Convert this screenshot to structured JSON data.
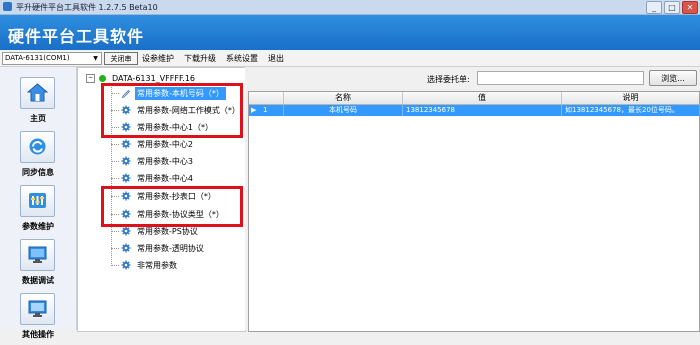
{
  "window": {
    "title": "平升硬件平台工具软件 1.2.7.5 Beta10",
    "minimize": "_",
    "maximize": "□",
    "close": "✕"
  },
  "banner": {
    "title": "硬件平台工具软件"
  },
  "toolbar": {
    "port_select": "DATA-6131(COM1)",
    "close_button": "关闭串",
    "menus": [
      "设参维护",
      "下载升级",
      "系统设置",
      "退出"
    ]
  },
  "sidebar": {
    "items": [
      {
        "label": "主页",
        "icon": "home-icon"
      },
      {
        "label": "同步信息",
        "icon": "sync-icon"
      },
      {
        "label": "参数维护",
        "icon": "parameters-icon"
      },
      {
        "label": "数据调试",
        "icon": "monitor-icon"
      },
      {
        "label": "其他操作",
        "icon": "computer-icon"
      }
    ]
  },
  "tree": {
    "root": "DATA-6131_VFFFF.16",
    "items": [
      "常用参数-本机号码（*）",
      "常用参数-网络工作模式（*）",
      "常用参数-中心1（*）",
      "常用参数-中心2",
      "常用参数-中心3",
      "常用参数-中心4",
      "常用参数-抄表口（*）",
      "常用参数-协议类型（*）",
      "常用参数-PS协议",
      "常用参数-透明协议",
      "非常用参数"
    ],
    "selected_index": 0
  },
  "delegate": {
    "label": "选择委托单:",
    "value": "",
    "browse": "浏览..."
  },
  "grid": {
    "columns": [
      "名称",
      "值",
      "说明"
    ],
    "rows": [
      {
        "marker": "▶",
        "index": "1",
        "name": "本机号码",
        "value": "13812345678",
        "desc": "如13812345678，最长20位号码。"
      }
    ]
  },
  "colors": {
    "banner": "#1a6fc7",
    "selection": "#3399ff",
    "highlight_box": "#e0101a",
    "status_dot": "#1db31d"
  }
}
